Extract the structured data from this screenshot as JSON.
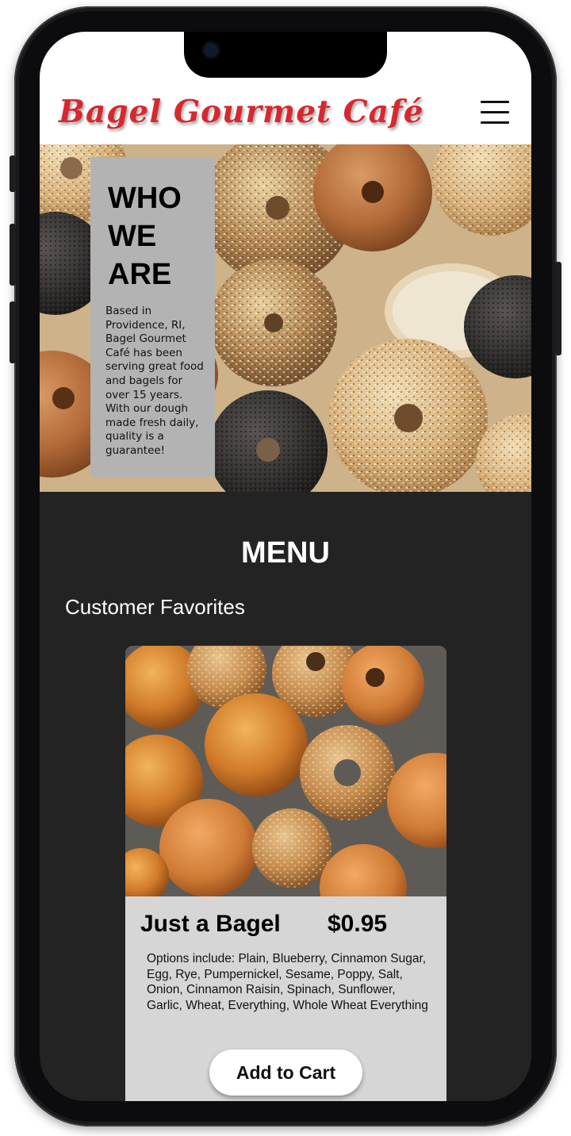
{
  "header": {
    "logo_text": "Bagel Gourmet Café",
    "menu_icon": "hamburger-menu-icon"
  },
  "hero": {
    "title": "WHO WE ARE",
    "body": "Based in Providence, RI, Bagel Gourmet Café has been serving great food and bagels for over 15 years. With our dough made fresh daily, quality is a guarantee!"
  },
  "menu": {
    "title": "MENU",
    "section_title": "Customer Favorites",
    "items": [
      {
        "name": "Just a Bagel",
        "price": "$0.95",
        "description": "Options include: Plain, Blueberry, Cinnamon Sugar, Egg, Rye, Pumpernickel, Sesame, Poppy, Salt, Onion, Cinnamon Raisin, Spinach, Sunflower, Garlic, Wheat, Everything, Whole Wheat Everything",
        "button_label": "Add to Cart"
      }
    ]
  },
  "colors": {
    "brand_red": "#d5292f",
    "page_dark": "#232323",
    "card_bg": "#d6d6d6",
    "info_box": "#b3b3b3"
  }
}
